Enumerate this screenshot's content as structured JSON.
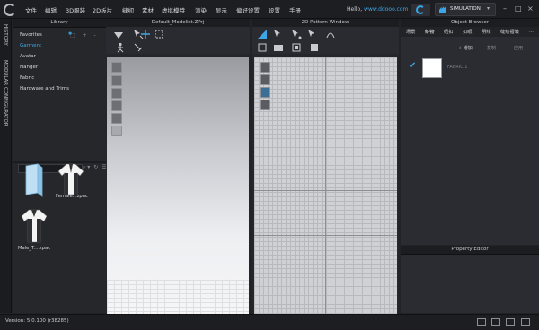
{
  "menu": {
    "items": [
      "文件",
      "编辑",
      "3D服装",
      "2D板片",
      "缝纫",
      "素材",
      "虚拟模特",
      "渲染",
      "显示",
      "偏好设置",
      "设置",
      "手册"
    ],
    "hello_text": "Hello,",
    "hello_user": "www.ddooo.com",
    "simulation_label": "SIMULATION"
  },
  "left_strip": {
    "top_label": "HISTORY",
    "second_label": "MODULAR CONFIGURATOR"
  },
  "library": {
    "title": "Library",
    "items": [
      "Favorites",
      "Garment",
      "Avatar",
      "Hanger",
      "Fabric",
      "Hardware and Trims"
    ],
    "active_item": "Garment",
    "files": [
      {
        "label": ""
      },
      {
        "label": "Female...zpac"
      },
      {
        "label": "Male_T....zpac"
      }
    ]
  },
  "viewport3d": {
    "title": "Default_Modelist.ZPrj"
  },
  "viewport2d": {
    "title": "2D Pattern Window"
  },
  "object_browser": {
    "title": "Object Browser",
    "tabs": [
      "场景",
      "织物",
      "纽扣",
      "扣眼",
      "明线",
      "缝纫褶皱",
      "..."
    ],
    "active_tab": "织物",
    "actions": [
      "+ 增加",
      "复制",
      "应用"
    ],
    "fabric_name": "FABRIC 1"
  },
  "property_editor": {
    "title": "Property Editor"
  },
  "status": {
    "version": "Version: 5.0.100 (r38285)"
  },
  "colors": {
    "accent": "#3ea6e6",
    "background": "#222326",
    "panel": "#2b2c31"
  }
}
